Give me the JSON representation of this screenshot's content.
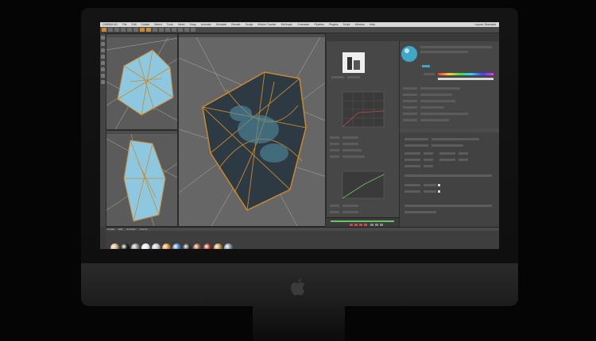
{
  "menubar": {
    "items": [
      "CINEMA 4D",
      "File",
      "Edit",
      "Create",
      "Select",
      "Tools",
      "Mesh",
      "Snap",
      "Animate",
      "Simulate",
      "Render",
      "Sculpt",
      "Motion Tracker",
      "MoGraph",
      "Character",
      "Pipeline",
      "Plugins",
      "Script",
      "Window",
      "Help"
    ],
    "right_label": "Layout: Standard"
  },
  "material_tabs": [
    "Create",
    "Edit",
    "Function",
    "Texture"
  ],
  "colors": {
    "accent": "#c98a2e",
    "mesh_fill": "#8ec8e0",
    "viewport_bg": "#5b5b5b"
  },
  "materials": [
    {
      "name": "mat-tan",
      "color": "#c8a47a"
    },
    {
      "name": "mat-black",
      "color": "#1a1a1a"
    },
    {
      "name": "mat-grey",
      "color": "#8a8a8a"
    },
    {
      "name": "mat-white",
      "color": "#e8e8e8"
    },
    {
      "name": "mat-silver",
      "color": "#bfbfbf"
    },
    {
      "name": "mat-orange",
      "color": "#d8862a"
    },
    {
      "name": "mat-blue",
      "color": "#3f7fbf"
    },
    {
      "name": "mat-dark",
      "color": "#333333"
    },
    {
      "name": "mat-rust",
      "color": "#8a4a2a"
    },
    {
      "name": "mat-red",
      "color": "#9a2a20"
    },
    {
      "name": "mat-gold",
      "color": "#b88a3a"
    },
    {
      "name": "mat-steel",
      "color": "#7a8a94"
    }
  ]
}
